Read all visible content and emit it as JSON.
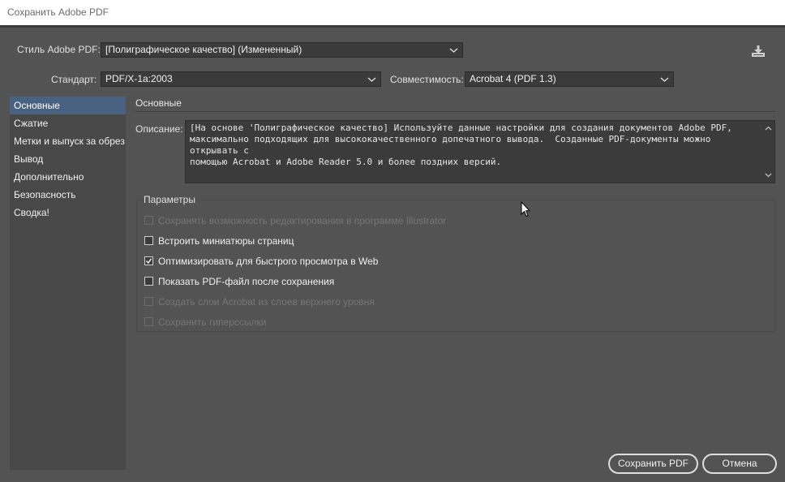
{
  "window": {
    "title": "Сохранить Adobe PDF"
  },
  "preset": {
    "label": "Стиль Adobe PDF:",
    "value": "[Полиграфическое качество] (Измененный)"
  },
  "standard": {
    "label": "Стандарт:",
    "value": "PDF/X-1a:2003"
  },
  "compat": {
    "label": "Совместимость:",
    "value": "Acrobat 4 (PDF 1.3)"
  },
  "icons": {
    "export": "save-preset-icon",
    "dropdown": "chevron-down-icon",
    "cursor": "mouse-cursor-icon"
  },
  "nav": {
    "items": [
      {
        "label": "Основные",
        "selected": true
      },
      {
        "label": "Сжатие"
      },
      {
        "label": "Метки и выпуск за обрез"
      },
      {
        "label": "Вывод"
      },
      {
        "label": "Дополнительно"
      },
      {
        "label": "Безопасность"
      },
      {
        "label": "Сводка!"
      }
    ]
  },
  "section": {
    "title": "Основные"
  },
  "description": {
    "label": "Описание:",
    "text": "[На основе 'Полиграфическое качество] Используйте данные настройки для создания документов Adobe PDF,\nмаксимально подходящих для высококачественного допечатного вывода.  Созданные PDF-документы можно открывать с\nпомощью Acrobat и Adobe Reader 5.0 и более поздних версий."
  },
  "params": {
    "title": "Параметры",
    "options": [
      {
        "label": "Сохранять возможность редактирования в программе Illustrator",
        "checked": false,
        "disabled": true
      },
      {
        "label": "Встроить миниатюры страниц",
        "checked": false,
        "disabled": false
      },
      {
        "label": "Оптимизировать для быстрого просмотра в Web",
        "checked": true,
        "disabled": false
      },
      {
        "label": "Показать PDF-файл после сохранения",
        "checked": false,
        "disabled": false
      },
      {
        "label": "Создать слои Acrobat из слоев верхнего уровня",
        "checked": false,
        "disabled": true
      },
      {
        "label": "Сохранить гиперссылки",
        "checked": false,
        "disabled": true
      }
    ]
  },
  "buttons": {
    "save": "Сохранить PDF",
    "cancel": "Отмена"
  },
  "colors": {
    "background": "#535353",
    "selection": "#4a6282",
    "field": "#3b3b3b"
  }
}
